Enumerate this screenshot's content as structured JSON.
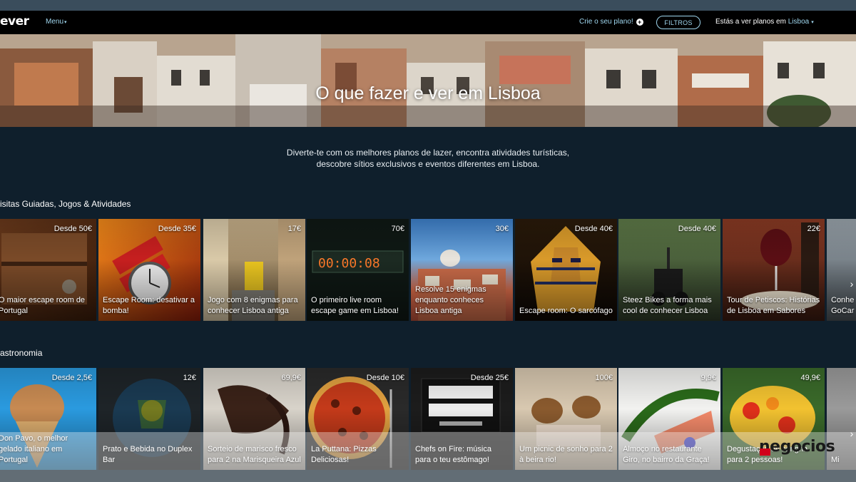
{
  "navbar": {
    "logo": "ever",
    "menu_label": "Menu",
    "create_plan_label": "Crie o seu plano!",
    "filters_label": "FILTROS",
    "city_prefix": "Estás a ver planos em",
    "city": "Lisboa"
  },
  "hero": {
    "title": "O que fazer e ver em Lisboa"
  },
  "intro": "Diverte-te com os melhores planos de lazer, encontra atividades turísticas, descobre sítios exclusivos e eventos diferentes em Lisboa.",
  "sections": [
    {
      "title": "isitas Guiadas, Jogos & Atividades",
      "cards": [
        {
          "price": "Desde 50€",
          "title": "O maior escape room de Portugal"
        },
        {
          "price": "Desde 35€",
          "title": "Escape Room: desativar a bomba!"
        },
        {
          "price": "17€",
          "title": "Jogo com 8 enigmas para conhecer Lisboa antiga"
        },
        {
          "price": "70€",
          "title": "O primeiro live room escape game em Lisboa!"
        },
        {
          "price": "30€",
          "title": "Resolve 15 enigmas enquanto conheces Lisboa antiga"
        },
        {
          "price": "Desde 40€",
          "title": "Escape room: O sarcófago"
        },
        {
          "price": "Desde 40€",
          "title": "Steez Bikes a forma mais cool de conhecer Lisboa"
        },
        {
          "price": "22€",
          "title": "Tour de Petiscos: Histórias de Lisboa em Sabores"
        },
        {
          "price": "",
          "title": "Conhe GoCar"
        }
      ]
    },
    {
      "title": "astronomia",
      "cards": [
        {
          "price": "Desde 2,5€",
          "title": "Don Pavo, o melhor gelado italiano em Portugal"
        },
        {
          "price": "12€",
          "title": "Prato e Bebida no Duplex Bar"
        },
        {
          "price": "69,9€",
          "title": "Sorteio de marisco fresco para 2 na Marisqueira Azul"
        },
        {
          "price": "Desde 10€",
          "title": "La Puttana: Pizzas Deliciosas!"
        },
        {
          "price": "Desde 25€",
          "title": "Chefs on Fire: música para o teu estômago!"
        },
        {
          "price": "100€",
          "title": "Um picnic de sonho para 2 à beira rio!"
        },
        {
          "price": "9,9€",
          "title": "Almoço no restaurante Giro, no bairro da Graça!"
        },
        {
          "price": "49,9€",
          "title": "Degustação de sangria para 2 pessoas!"
        },
        {
          "price": "",
          "title": "Mi"
        }
      ]
    }
  ],
  "watermark": "negocios",
  "colors": {
    "page_bg": "#0f1f2c",
    "accent": "#9fd6ee",
    "brand_red": "#d0021b"
  },
  "icons": [
    "plus-circle-icon",
    "caret-down-icon",
    "chevron-right-icon"
  ]
}
